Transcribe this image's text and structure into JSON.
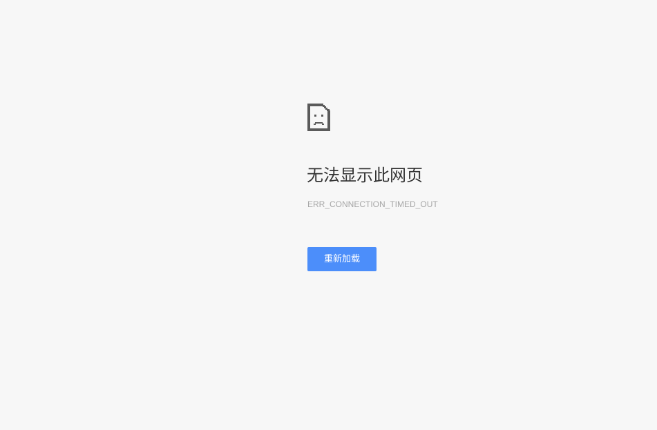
{
  "error": {
    "icon": "sad-document-icon",
    "title": "无法显示此网页",
    "code": "ERR_CONNECTION_TIMED_OUT",
    "reload_label": "重新加载"
  },
  "colors": {
    "background": "#f7f7f7",
    "title": "#333333",
    "code": "#a6a6a6",
    "button": "#4c8efa",
    "icon": "#5a5a5a"
  }
}
